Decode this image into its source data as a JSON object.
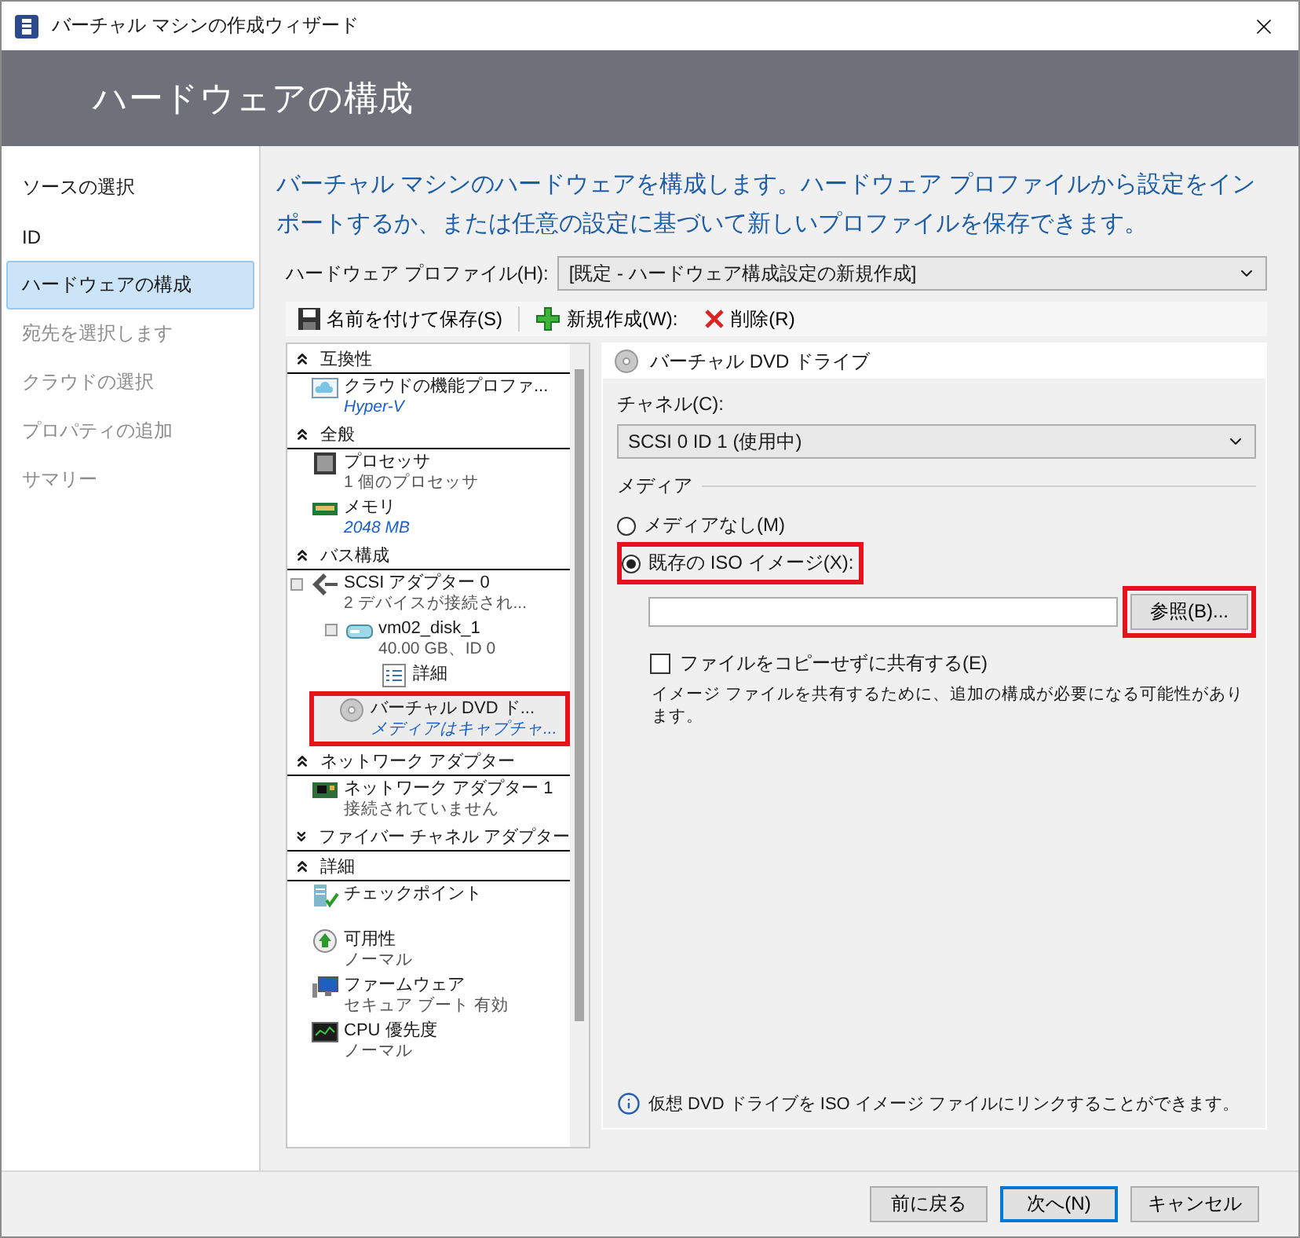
{
  "window": {
    "title": "バーチャル マシンの作成ウィザード"
  },
  "header": {
    "title": "ハードウェアの構成"
  },
  "steps": [
    {
      "label": "ソースの選択",
      "selected": false,
      "disabled": false
    },
    {
      "label": "ID",
      "selected": false,
      "disabled": false
    },
    {
      "label": "ハードウェアの構成",
      "selected": true,
      "disabled": false
    },
    {
      "label": "宛先を選択します",
      "selected": false,
      "disabled": true
    },
    {
      "label": "クラウドの選択",
      "selected": false,
      "disabled": true
    },
    {
      "label": "プロパティの追加",
      "selected": false,
      "disabled": true
    },
    {
      "label": "サマリー",
      "selected": false,
      "disabled": true
    }
  ],
  "description": "バーチャル マシンのハードウェアを構成します。ハードウェア プロファイルから設定をインポートするか、または任意の設定に基づいて新しいプロファイルを保存できます。",
  "profile": {
    "label": "ハードウェア プロファイル(H):",
    "value": "[既定 - ハードウェア構成設定の新規作成]"
  },
  "toolbar": [
    {
      "kind": "save",
      "label": "名前を付けて保存(S)"
    },
    {
      "kind": "new",
      "label": "新規作成(W):"
    },
    {
      "kind": "delete",
      "label": "削除(R)"
    }
  ],
  "tree": [
    {
      "title": "互換性",
      "expanded": true,
      "items": [
        {
          "kind": "cloud",
          "title": "クラウドの機能プロファ...",
          "subtitle": "Hyper-V",
          "subtitle_link": true,
          "selected": false,
          "highlighted": false
        }
      ]
    },
    {
      "title": "全般",
      "expanded": true,
      "items": [
        {
          "kind": "cpu",
          "title": "プロセッサ",
          "subtitle": "1 個のプロセッサ",
          "subtitle_link": false,
          "selected": false,
          "highlighted": false
        },
        {
          "kind": "memory",
          "title": "メモリ",
          "subtitle": "2048 MB",
          "subtitle_link": true,
          "selected": false,
          "highlighted": false
        }
      ]
    },
    {
      "title": "バス構成",
      "expanded": true,
      "items": [
        {
          "kind": "scsi",
          "title": "SCSI アダプター 0",
          "subtitle": "2 デバイスが接続され...",
          "subtitle_link": false,
          "selected": false,
          "highlighted": false,
          "children": [
            {
              "kind": "disk",
              "title": "vm02_disk_1",
              "subtitle": "40.00 GB、ID 0",
              "subtitle_link": false,
              "selected": false,
              "highlighted": false,
              "children": [
                {
                  "kind": "details",
                  "title": "詳細",
                  "selected": false,
                  "highlighted": false
                }
              ]
            },
            {
              "kind": "dvd",
              "title": "バーチャル DVD ド...",
              "subtitle": "メディアはキャプチャ...",
              "subtitle_link": true,
              "selected": true,
              "highlighted": true
            }
          ]
        }
      ]
    },
    {
      "title": "ネットワーク アダプター",
      "expanded": true,
      "items": [
        {
          "kind": "nic",
          "title": "ネットワーク アダプター 1",
          "subtitle": "接続されていません",
          "subtitle_link": false,
          "selected": false,
          "highlighted": false
        }
      ]
    },
    {
      "title": "ファイバー チャネル アダプター",
      "expanded": false
    },
    {
      "title": "詳細",
      "expanded": true,
      "items": [
        {
          "kind": "checkpoint",
          "title": "チェックポイント",
          "selected": false,
          "highlighted": false
        },
        {
          "kind": "availability",
          "title": "可用性",
          "subtitle": "ノーマル",
          "subtitle_link": false,
          "selected": false,
          "highlighted": false
        },
        {
          "kind": "firmware",
          "title": "ファームウェア",
          "subtitle": "セキュア ブート 有効",
          "subtitle_link": false,
          "selected": false,
          "highlighted": false
        },
        {
          "kind": "priority",
          "title": "CPU 優先度",
          "subtitle": "ノーマル",
          "subtitle_link": false,
          "selected": false,
          "highlighted": false
        }
      ]
    }
  ],
  "device": {
    "title": "バーチャル DVD ドライブ",
    "channel_label": "チャネル(C):",
    "channel_value": "SCSI 0 ID 1 (使用中)",
    "media_label": "メディア",
    "media_options": [
      {
        "label": "メディアなし(M)",
        "selected": false,
        "highlighted": false
      },
      {
        "label": "既存の ISO イメージ(X):",
        "selected": true,
        "highlighted": true
      }
    ],
    "browse": {
      "label": "参照(B)...",
      "highlighted": true
    },
    "share": {
      "label": "ファイルをコピーせずに共有する(E)",
      "checked": false,
      "note": "イメージ ファイルを共有するために、追加の構成が必要になる可能性があります。"
    },
    "info": "仮想 DVD ドライブを ISO イメージ ファイルにリンクすることができます。"
  },
  "footer": {
    "buttons": [
      {
        "label": "前に戻る",
        "default": false
      },
      {
        "label": "次へ(N)",
        "default": true
      },
      {
        "label": "キャンセル",
        "default": false
      }
    ]
  }
}
